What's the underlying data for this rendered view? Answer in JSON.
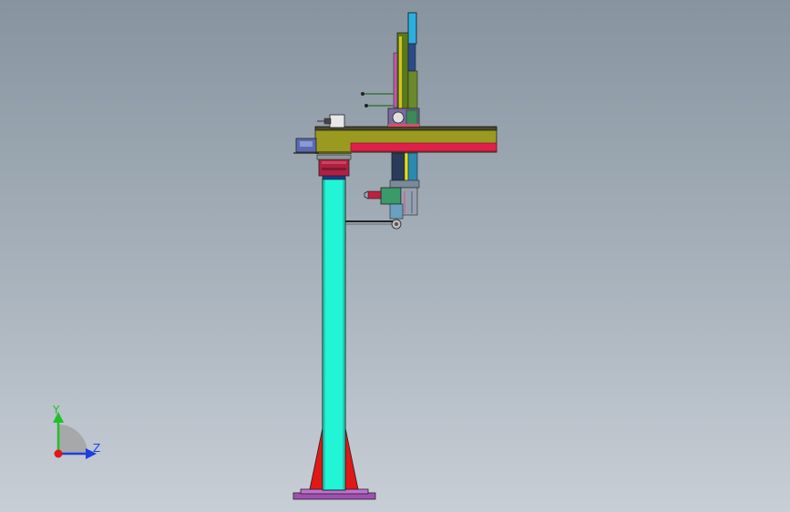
{
  "triad": {
    "y_label": "Y",
    "z_label": "Z",
    "y_color": "#22c02a",
    "z_color": "#1f3fe0",
    "x_color": "#e01818"
  },
  "colors": {
    "column": "#22f5d6",
    "beam": "#9a9a20",
    "beam_stripe": "#e0204a",
    "gusset": "#e01818",
    "base_plate": "#a050b0",
    "flange": "#b02040",
    "mast": "#2ab0e0",
    "vertical_rail": "#5a7a1a"
  }
}
